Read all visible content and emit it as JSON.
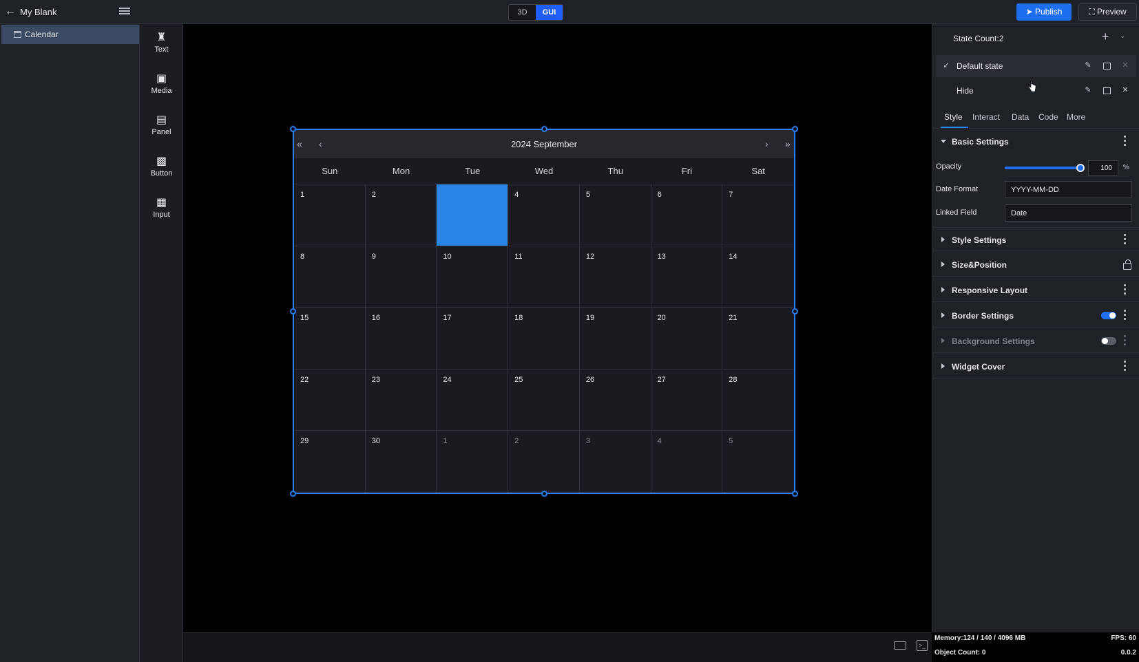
{
  "topbar": {
    "title": "My Blank",
    "mode_3d": "3D",
    "mode_gui": "GUI",
    "publish_label": "Publish",
    "preview_label": "Preview",
    "accent": "#1f5ef7"
  },
  "tree": {
    "items": [
      {
        "label": "Calendar",
        "icon": "calendar-icon"
      }
    ]
  },
  "palette": {
    "items": [
      {
        "label": "Text",
        "icon": "text-icon"
      },
      {
        "label": "Media",
        "icon": "media-icon"
      },
      {
        "label": "Panel",
        "icon": "panel-icon"
      },
      {
        "label": "Button",
        "icon": "button-icon"
      },
      {
        "label": "Input",
        "icon": "input-icon"
      }
    ]
  },
  "calendar": {
    "month_label": "2024 September",
    "weekdays": [
      "Sun",
      "Mon",
      "Tue",
      "Wed",
      "Thu",
      "Fri",
      "Sat"
    ],
    "days": [
      "1",
      "2",
      "",
      "4",
      "5",
      "6",
      "7",
      "8",
      "9",
      "10",
      "11",
      "12",
      "13",
      "14",
      "15",
      "16",
      "17",
      "18",
      "19",
      "20",
      "21",
      "22",
      "23",
      "24",
      "25",
      "26",
      "27",
      "28",
      "29",
      "30",
      "1",
      "2",
      "3",
      "4",
      "5"
    ],
    "other_month_from_index": 30,
    "selected_index": 2,
    "selected_color": "#2a86e6",
    "border_color": "#2a7fff"
  },
  "props": {
    "state_count": "State Count:2",
    "states": [
      {
        "name": "Default state",
        "checked": true
      },
      {
        "name": "Hide",
        "checked": false
      }
    ],
    "tabs": [
      "Style",
      "Interact",
      "Data",
      "Code",
      "More"
    ],
    "active_tab": "Style",
    "basic_settings": {
      "title": "Basic Settings",
      "opacity_label": "Opacity",
      "opacity_value": "100",
      "opacity_level": 1.0,
      "opacity_unit": "%",
      "date_format_label": "Date Format",
      "date_format_value": "YYYY-MM-DD",
      "linked_field_label": "Linked Field",
      "linked_field_value": "Date"
    },
    "sections": [
      {
        "title": "Style Settings",
        "control": "kebab"
      },
      {
        "title": "Size&Position",
        "control": "lock"
      },
      {
        "title": "Responsive Layout",
        "control": "kebab"
      },
      {
        "title": "Border Settings",
        "control": "toggle-on"
      },
      {
        "title": "Background Settings",
        "control": "toggle-off"
      },
      {
        "title": "Widget Cover",
        "control": "kebab"
      }
    ]
  },
  "status": {
    "memory": "Memory:124 / 140 / 4096 MB",
    "fps": "FPS: 60",
    "object_count": "Object Count: 0",
    "version": "0.0.2"
  }
}
